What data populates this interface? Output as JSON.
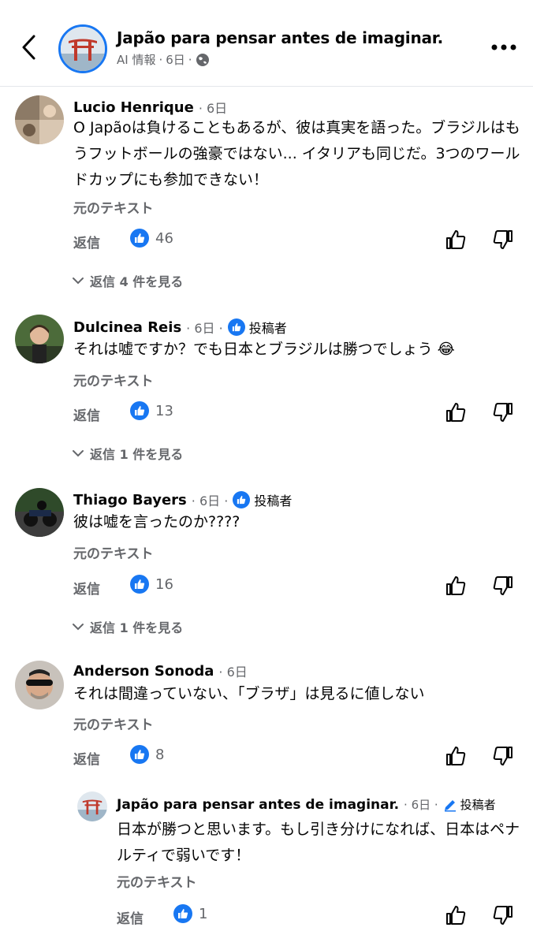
{
  "header": {
    "title": "Japão para pensar antes de imaginar.",
    "sub_label": "AI 情報",
    "sub_dot": "·",
    "sub_time": "6日",
    "sub_dot2": "·"
  },
  "common": {
    "original_text_label": "元のテキスト",
    "reply_label": "返信",
    "author_badge_label": "投稿者"
  },
  "comments": [
    {
      "name": "Lucio Henrique",
      "time": "6日",
      "text": "O Japãoは負けることもあるが、彼は真実を語った。ブラジルはもうフットボールの強豪ではない... イタリアも同じだ。3つのワールドカップにも参加できない！",
      "likes": "46",
      "replies_label": "返信 4 件を見る"
    },
    {
      "name": "Dulcinea Reis",
      "time": "6日",
      "text": "それは嘘ですか？でも日本とブラジルは勝つでしょう 😂",
      "likes": "13",
      "replies_label": "返信 1 件を見る"
    },
    {
      "name": "Thiago Bayers",
      "time": "6日",
      "text": "彼は嘘を言ったのか????",
      "likes": "16",
      "replies_label": "返信 1 件を見る"
    },
    {
      "name": "Anderson Sonoda",
      "time": "6日",
      "text": "それは間違っていない、「ブラザ」は見るに値しない",
      "likes": "8"
    }
  ],
  "reply": {
    "name": "Japão para pensar antes de imaginar.",
    "time": "6日",
    "text": "日本が勝つと思います。もし引き分けになれば、日本はペナルティで弱いです！",
    "likes": "1"
  },
  "colors": {
    "accent": "#1877f2",
    "secondary_text": "#65676b",
    "primary_text": "#050505"
  }
}
